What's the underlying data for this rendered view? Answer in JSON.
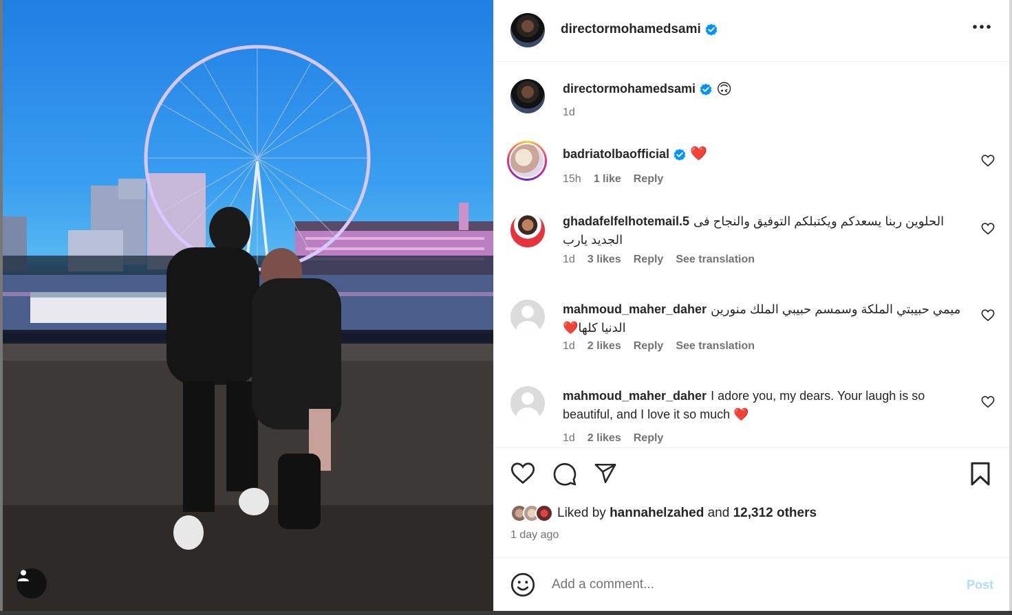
{
  "post": {
    "author": "directormohamedsami",
    "caption_emoji": "🙃",
    "caption_time": "1d"
  },
  "comments": [
    {
      "user": "badriatolbaofficial",
      "verified": true,
      "text": "❤️",
      "time": "15h",
      "likes": "1 like",
      "reply": "Reply"
    },
    {
      "user": "ghadafelfelhotemail.5",
      "text": "الحلوين ربنا يسعدكم ويكتبلكم التوفيق والنجاح فى الجديد يارب",
      "time": "1d",
      "likes": "3 likes",
      "reply": "Reply",
      "translate": "See translation"
    },
    {
      "user": "mahmoud_maher_daher",
      "text": "ميمي حبيبتي الملكة وسمسم حبيبي الملك منورين الدنيا كلها❤️",
      "time": "1d",
      "likes": "2 likes",
      "reply": "Reply",
      "translate": "See translation"
    },
    {
      "user": "mahmoud_maher_daher",
      "text": "I adore you, my dears. Your laugh is so beautiful, and I love it so much ❤️",
      "time": "1d",
      "likes": "2 likes",
      "reply": "Reply"
    }
  ],
  "likes": {
    "prefix": "Liked by",
    "user": "hannahelzahed",
    "middle": "and",
    "others": "12,312 others"
  },
  "time_ago": "1 day ago",
  "composer": {
    "placeholder": "Add a comment...",
    "post_label": "Post"
  },
  "colors": {
    "verified": "#0095f6",
    "heart_red": "#ed4956",
    "post_disabled": "#b3dbff"
  }
}
